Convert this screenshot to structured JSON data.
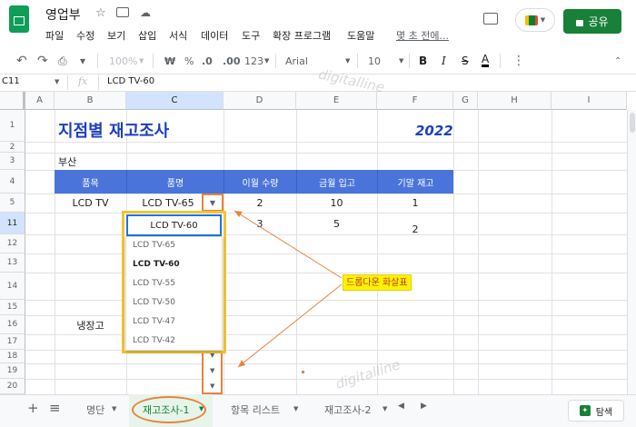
{
  "title_bar": {
    "doc_title": "영업부",
    "share_label": "공유"
  },
  "menu": [
    "파일",
    "수정",
    "보기",
    "삽입",
    "서식",
    "데이터",
    "도구",
    "확장 프로그램",
    "도움말"
  ],
  "menu_last_edit": "몇 초 전에...",
  "toolbar": {
    "zoom": "100%",
    "currency": "₩",
    "percent": "%",
    "dec_decrease": ".0",
    "dec_increase": ".00",
    "format_more": "123",
    "font": "Arial",
    "font_size": "10",
    "bold": "B",
    "italic": "I",
    "strike": "S",
    "text_color": "A",
    "more": "⋮"
  },
  "formula_bar": {
    "cell_ref": "C11",
    "fx": "fx",
    "value": "LCD TV-60"
  },
  "columns": [
    "A",
    "B",
    "C",
    "D",
    "E",
    "F",
    "G",
    "H",
    "I"
  ],
  "rows": [
    "1",
    "2",
    "3",
    "4",
    "5",
    "11",
    "12",
    "13",
    "14",
    "15",
    "16",
    "17",
    "18",
    "19",
    "20"
  ],
  "sheet": {
    "title": "지점별 재고조사",
    "year": "2022",
    "region": "부산",
    "headers": [
      "품목",
      "품명",
      "이월 수량",
      "금월 입고",
      "기말 재고"
    ],
    "row5": {
      "item": "LCD TV",
      "name": "LCD TV-65",
      "carry": "2",
      "incoming": "10",
      "stock": "1"
    },
    "row11": {
      "name": "LCD TV-60",
      "carry": "3",
      "incoming": "5",
      "stock": "2"
    },
    "row16_item": "냉장고"
  },
  "dropdown": {
    "options": [
      "LCD TV-65",
      "LCD TV-60",
      "LCD TV-55",
      "LCD TV-50",
      "LCD TV-47",
      "LCD TV-42"
    ],
    "selected_index": 1
  },
  "annotation": {
    "label": "드롭다운 화살표",
    "watermark": "digitalline"
  },
  "tabs": {
    "add": "+",
    "list": "≡",
    "items": [
      "명단",
      "재고조사-1",
      "항목 리스트",
      "재고조사-2"
    ],
    "active_index": 1,
    "explore": "탐색"
  },
  "colors": {
    "accent": "#188038",
    "header_fill": "#4a74d9",
    "title_color": "#1f3fbf",
    "highlight": "#f2c531",
    "callout": "#e8833a",
    "label_bg": "#fff200"
  }
}
